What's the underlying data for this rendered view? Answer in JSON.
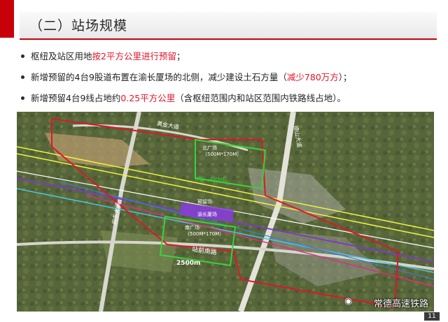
{
  "title": "（二）站场规模",
  "bullets": [
    {
      "pre": "枢纽及站区用地",
      "hl": "按2平方公里进行预留",
      "post": "；"
    },
    {
      "pre": "新增预留的4台9股道布置在渝长厦场的北侧，减少建设土石方量（",
      "hl": "减少780万方",
      "post": "）；"
    },
    {
      "pre": "新增预留4台9线占地约",
      "hl": "0.25平方公里",
      "post": "（含枢纽范围内和站区范围内铁路线占地）。"
    }
  ],
  "map": {
    "road_labels": [
      "黄金大道",
      "德山大道",
      "向东大道",
      "站前南路"
    ],
    "plaza_north": "北广场",
    "plaza_north_size": "（500M*170M）",
    "plaza_south": "南广场",
    "plaza_south_size": "（500M*170M）",
    "reserve_label": "预留（4台9线）",
    "station_label": "渝长厦场",
    "station_label2": "预留场",
    "distance": "2500m"
  },
  "watermark": "常德高速铁路",
  "page_number": "11",
  "colors": {
    "accent": "#c8000a",
    "highlight": "#e0152a"
  }
}
